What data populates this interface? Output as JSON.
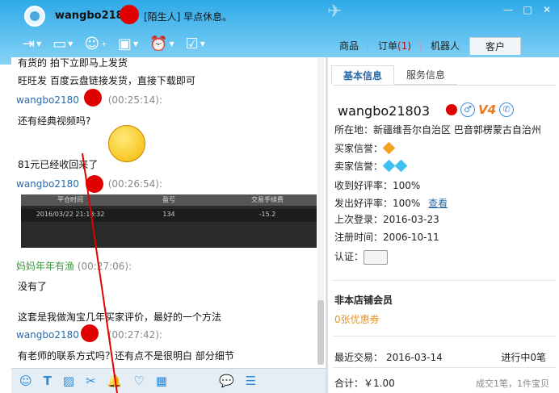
{
  "window": {
    "contact_name": "wangbo2180",
    "contact_status": "[陌生人] 早点休息。",
    "minimize": "—",
    "maximize": "□",
    "close": "✕"
  },
  "toolbar": {
    "icons": [
      "send-file-icon",
      "video-call-icon",
      "add-contact-icon",
      "share-screen-icon",
      "reminder-icon",
      "task-icon"
    ]
  },
  "right_tabs": [
    {
      "label": "商品"
    },
    {
      "label": "订单",
      "badge": "(1)"
    },
    {
      "label": "机器人"
    },
    {
      "label": "客户"
    }
  ],
  "chat": {
    "top_partial": "有货的 拍下立即马上发货",
    "messages": [
      {
        "text": "旺旺发 百度云盘链接发货，直接下载即可"
      },
      {
        "sender": "wangbo2180",
        "time": "(00:25:14):"
      },
      {
        "text": "还有经典视频吗?"
      },
      {
        "text": "81元已经收回来了"
      },
      {
        "sender": "wangbo2180",
        "time": "(00:26:54):"
      },
      {
        "sender": "妈妈年年有渔",
        "time": "(00:27:06):"
      },
      {
        "text": "没有了"
      },
      {
        "text": "这套是我做淘宝几年买家评价，最好的一个方法"
      },
      {
        "sender": "wangbo2180",
        "time": "(00:27:42):"
      },
      {
        "text": "有老师的联系方式吗？还有点不是很明白 部分细节"
      }
    ],
    "screenshot_table": {
      "headers": [
        "平仓时间",
        "盈亏",
        "交易手续费"
      ],
      "row": [
        "2016/03/22 21:18:32",
        "134",
        "-15.2"
      ]
    }
  },
  "bottom_icons": [
    "emoji-icon",
    "font-icon",
    "image-icon",
    "scissors-icon",
    "bell-icon",
    "heart-icon",
    "calculator-icon",
    "chat-bubble-icon",
    "history-icon"
  ],
  "info_panel": {
    "tabs": [
      "基本信息",
      "服务信息"
    ],
    "username": "wangbo21803",
    "level": "V4",
    "rows": {
      "location_label": "所在地：",
      "location": "新疆维吾尔自治区 巴音郭楞蒙古自治州",
      "buyer_credit_label": "买家信誉：",
      "seller_credit_label": "卖家信誉：",
      "received_rate_label": "收到好评率：",
      "received_rate": "100%",
      "given_rate_label": "发出好评率：",
      "given_rate": "100%",
      "view_link": "查看",
      "last_login_label": "上次登录：",
      "last_login": "2016-03-23",
      "register_label": "注册时间：",
      "register": "2006-10-11",
      "auth_label": "认证："
    },
    "member": "非本店铺会员",
    "coupon": "0张优惠券",
    "recent_label": "最近交易：",
    "recent_date": "2016-03-14",
    "in_progress": "进行中0笔",
    "total": "合计：￥1.00",
    "total_summary": "成交1笔，1件宝贝"
  }
}
